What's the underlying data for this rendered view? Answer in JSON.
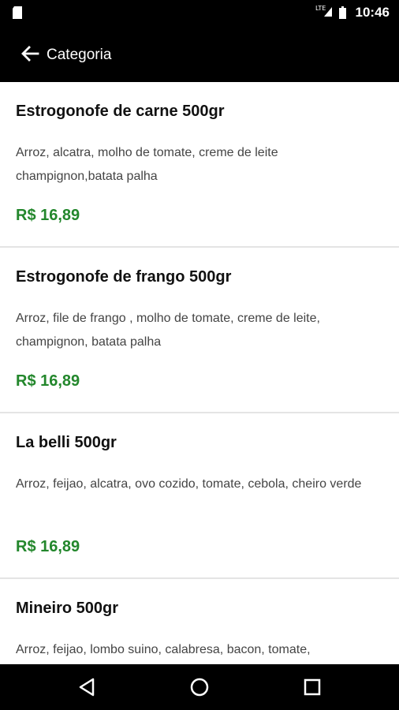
{
  "status_bar": {
    "network": "LTE",
    "time": "10:46"
  },
  "app_bar": {
    "title": "Categoria",
    "back_icon": "arrow-left-icon"
  },
  "colors": {
    "app_bar_bg": "#000000",
    "price": "#23872c",
    "divider": "#e4e4e4"
  },
  "items": [
    {
      "name": "Estrogonofe de carne 500gr",
      "description": "Arroz, alcatra, molho de tomate, creme de leite champignon,batata palha",
      "price": "R$ 16,89"
    },
    {
      "name": "Estrogonofe de frango 500gr",
      "description": "Arroz, file de frango , molho de tomate, creme de leite, champignon, batata palha",
      "price": "R$ 16,89"
    },
    {
      "name": "La belli 500gr",
      "description": "Arroz, feijao, alcatra, ovo cozido, tomate, cebola, cheiro verde",
      "price": "R$ 16,89"
    },
    {
      "name": "Mineiro 500gr",
      "description": "Arroz, feijao, lombo suino, calabresa, bacon, tomate,",
      "price": ""
    }
  ],
  "nav_bar": {
    "back_icon": "triangle-back-icon",
    "home_icon": "circle-home-icon",
    "recents_icon": "square-recents-icon"
  }
}
